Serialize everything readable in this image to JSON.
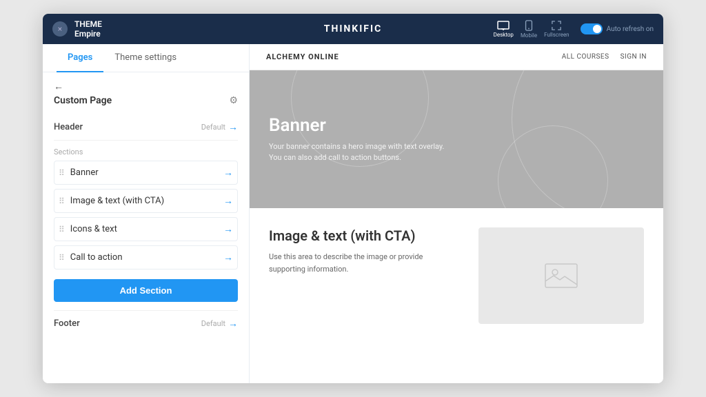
{
  "topbar": {
    "close_label": "×",
    "theme_meta": "THEME",
    "theme_name": "Empire",
    "app_title": "THINKIFIC",
    "views": [
      {
        "label": "Desktop",
        "active": true
      },
      {
        "label": "Mobile",
        "active": false
      },
      {
        "label": "Fullscreen",
        "active": false
      }
    ],
    "auto_refresh": "Auto refresh on"
  },
  "sidebar": {
    "tab_pages": "Pages",
    "tab_theme_settings": "Theme settings",
    "back_arrow": "←",
    "page_title": "Custom Page",
    "gear_label": "⚙",
    "header_label": "Header",
    "header_default": "Default",
    "header_arrow": "→",
    "sections_label": "Sections",
    "sections": [
      {
        "name": "Banner"
      },
      {
        "name": "Image & text (with CTA)"
      },
      {
        "name": "Icons & text"
      },
      {
        "name": "Call to action"
      }
    ],
    "add_section_btn": "Add Section",
    "footer_label": "Footer",
    "footer_default": "Default",
    "footer_arrow": "→"
  },
  "preview": {
    "brand": "ALCHEMY ONLINE",
    "nav_links": [
      "ALL COURSES",
      "SIGN IN"
    ],
    "banner": {
      "title": "Banner",
      "description": "Your banner contains a hero image with text overlay. You can also add call to action buttons."
    },
    "image_text": {
      "title": "Image & text (with CTA)",
      "description": "Use this area to describe the image or provide supporting information."
    }
  }
}
